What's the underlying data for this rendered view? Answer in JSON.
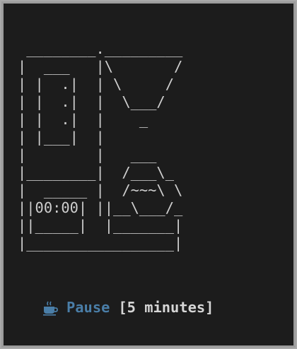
{
  "art": {
    "lines": [
      " ________._________",
      "|  ___   |\\       /",
      "| |  .|  | \\     / ",
      "| |  .|  |  \\___/  ",
      "| |  .|  |    _    ",
      "| |___|  |         ",
      "|        |   ___   ",
      "|________|  /___\\_ ",
      "|  _____ |  /~~~\\ \\",
      "||00:00| ||__\\___/_ ",
      "||_____|  |_______| ",
      "|_________________|"
    ]
  },
  "status": {
    "icon": "coffee-cup-icon",
    "pause_label": "Pause",
    "duration_label": "[5 minutes]",
    "colors": {
      "pause": "#4a7ea8",
      "duration": "#d6d6d6",
      "art": "#cfcfcf",
      "background": "#1c1c1c"
    }
  }
}
